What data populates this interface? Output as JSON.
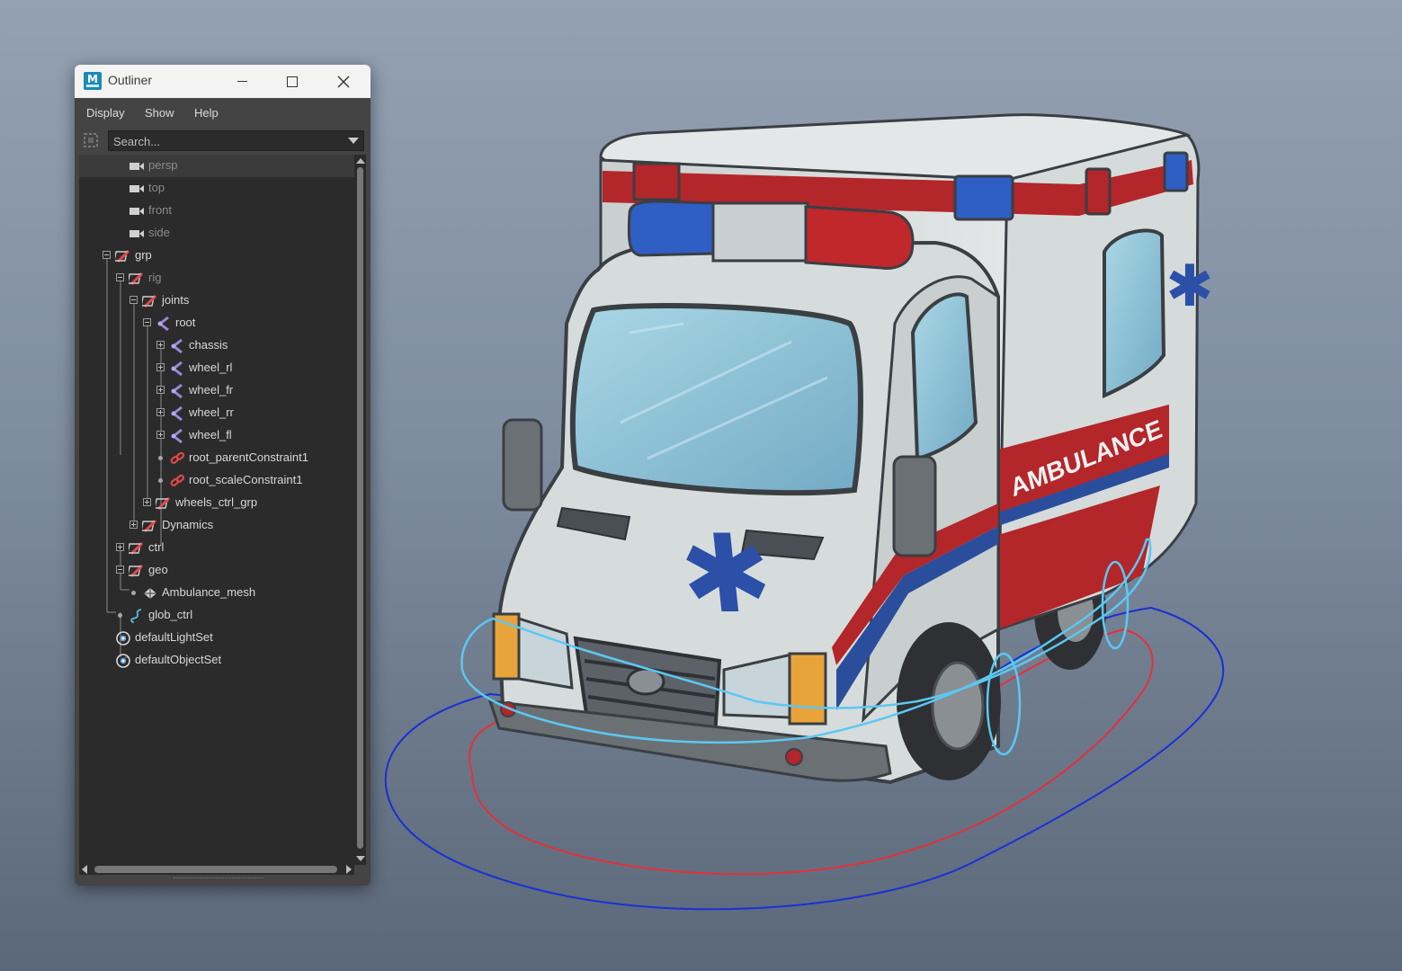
{
  "window": {
    "title": "Outliner",
    "app_icon_letter": "M"
  },
  "menu": [
    "Display",
    "Show",
    "Help"
  ],
  "search": {
    "placeholder": "Search..."
  },
  "tree": [
    {
      "label": "persp",
      "icon": "camera-icon",
      "dim": true,
      "selected": true
    },
    {
      "label": "top",
      "icon": "camera-icon",
      "dim": true
    },
    {
      "label": "front",
      "icon": "camera-icon",
      "dim": true
    },
    {
      "label": "side",
      "icon": "camera-icon",
      "dim": true
    },
    {
      "label": "grp",
      "icon": "group-icon",
      "toggle": "minus"
    },
    {
      "label": "rig",
      "icon": "group-icon",
      "dim": true,
      "toggle": "minus"
    },
    {
      "label": "joints",
      "icon": "group-icon",
      "toggle": "minus"
    },
    {
      "label": "root",
      "icon": "joint-icon",
      "toggle": "minus"
    },
    {
      "label": "chassis",
      "icon": "joint-icon",
      "toggle": "plus"
    },
    {
      "label": "wheel_rl",
      "icon": "joint-icon",
      "toggle": "plus"
    },
    {
      "label": "wheel_fr",
      "icon": "joint-icon",
      "toggle": "plus"
    },
    {
      "label": "wheel_rr",
      "icon": "joint-icon",
      "toggle": "plus"
    },
    {
      "label": "wheel_fl",
      "icon": "joint-icon",
      "toggle": "plus"
    },
    {
      "label": "root_parentConstraint1",
      "icon": "constraint-icon",
      "toggle": "dot"
    },
    {
      "label": "root_scaleConstraint1",
      "icon": "constraint-icon",
      "toggle": "dot"
    },
    {
      "label": "wheels_ctrl_grp",
      "icon": "group-icon",
      "toggle": "plus"
    },
    {
      "label": "Dynamics",
      "icon": "group-icon",
      "toggle": "plus"
    },
    {
      "label": "ctrl",
      "icon": "group-icon",
      "toggle": "plus"
    },
    {
      "label": "geo",
      "icon": "group-icon",
      "toggle": "minus"
    },
    {
      "label": "Ambulance_mesh",
      "icon": "mesh-icon",
      "toggle": "dot"
    },
    {
      "label": "glob_ctrl",
      "icon": "curve-icon",
      "toggle": "dot"
    },
    {
      "label": "defaultLightSet",
      "icon": "set-icon"
    },
    {
      "label": "defaultObjectSet",
      "icon": "set-icon"
    }
  ],
  "viewport": {
    "decal_text": "AMBULANCE"
  },
  "colors": {
    "viewport_top": "#93a1b2",
    "viewport_bottom": "#5b6879",
    "body_white": "#d9dedd",
    "stripe_red": "#b3262a",
    "stripe_blue": "#2b4e9c",
    "glass": "#8fc4d8",
    "ctrl_blue": "#1a2fd6",
    "ctrl_red": "#e3303c",
    "ctrl_cyan": "#5cc8f2"
  }
}
